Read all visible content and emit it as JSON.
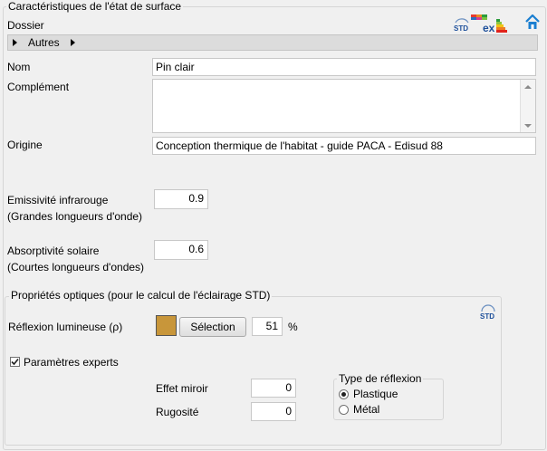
{
  "frame": {
    "title": "Caractéristiques de l'état de surface"
  },
  "header": {
    "folder_label": "Dossier",
    "std_icon_text": "STD",
    "ex_icon_text": "ex"
  },
  "tab": {
    "label": "Autres"
  },
  "form": {
    "name_label": "Nom",
    "name_value": "Pin clair",
    "complement_label": "Complément",
    "complement_value": "",
    "origin_label": "Origine",
    "origin_value": "Conception thermique de l'habitat - guide PACA - Edisud 88",
    "emissivity_label_1": "Emissivité infrarouge",
    "emissivity_label_2": "(Grandes longueurs d'onde)",
    "emissivity_value": "0.9",
    "absorptivity_label_1": "Absorptivité solaire",
    "absorptivity_label_2": "(Courtes longueurs d'ondes)",
    "absorptivity_value": "0.6"
  },
  "optics": {
    "title": "Propriétés optiques (pour le calcul de l'éclairage STD)",
    "std_icon_text": "STD",
    "reflection_label": "Réflexion lumineuse (ρ)",
    "swatch_color": "#c8963a",
    "select_button": "Sélection",
    "reflection_value": "51",
    "percent": "%",
    "experts_label": "Paramètres experts",
    "experts_checked": true,
    "mirror_label": "Effet miroir",
    "mirror_value": "0",
    "roughness_label": "Rugosité",
    "roughness_value": "0",
    "reflection_type": {
      "title": "Type de réflexion",
      "options": [
        "Plastique",
        "Métal"
      ],
      "selected": "Plastique"
    }
  }
}
